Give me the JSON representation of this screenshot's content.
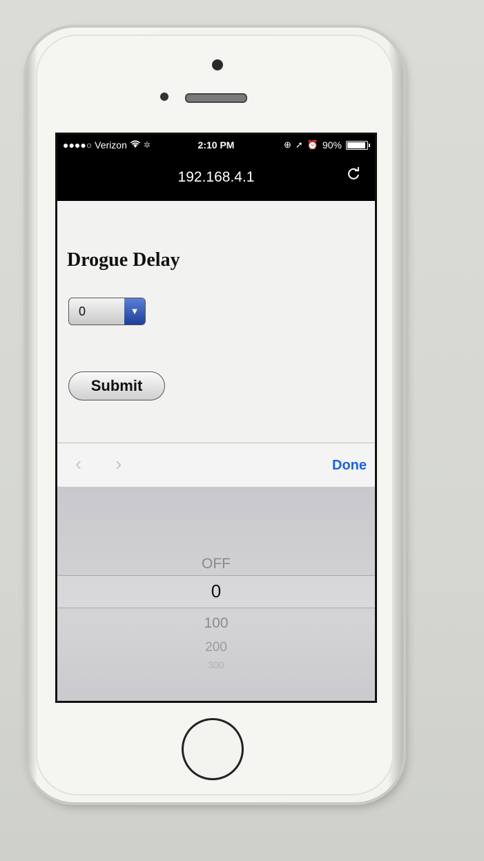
{
  "status": {
    "carrier": "●●●●○ Verizon",
    "time": "2:10 PM",
    "battery": "90%"
  },
  "browser": {
    "url": "192.168.4.1",
    "reload_icon": "reload-icon"
  },
  "page": {
    "heading": "Drogue Delay",
    "select_value": "0",
    "submit_label": "Submit"
  },
  "toolbar": {
    "prev": "‹",
    "next": "›",
    "done_label": "Done",
    "done_color": "#1a63e0"
  },
  "picker": {
    "options": [
      "OFF",
      "0",
      "100",
      "200",
      "300"
    ],
    "selected": "0"
  }
}
